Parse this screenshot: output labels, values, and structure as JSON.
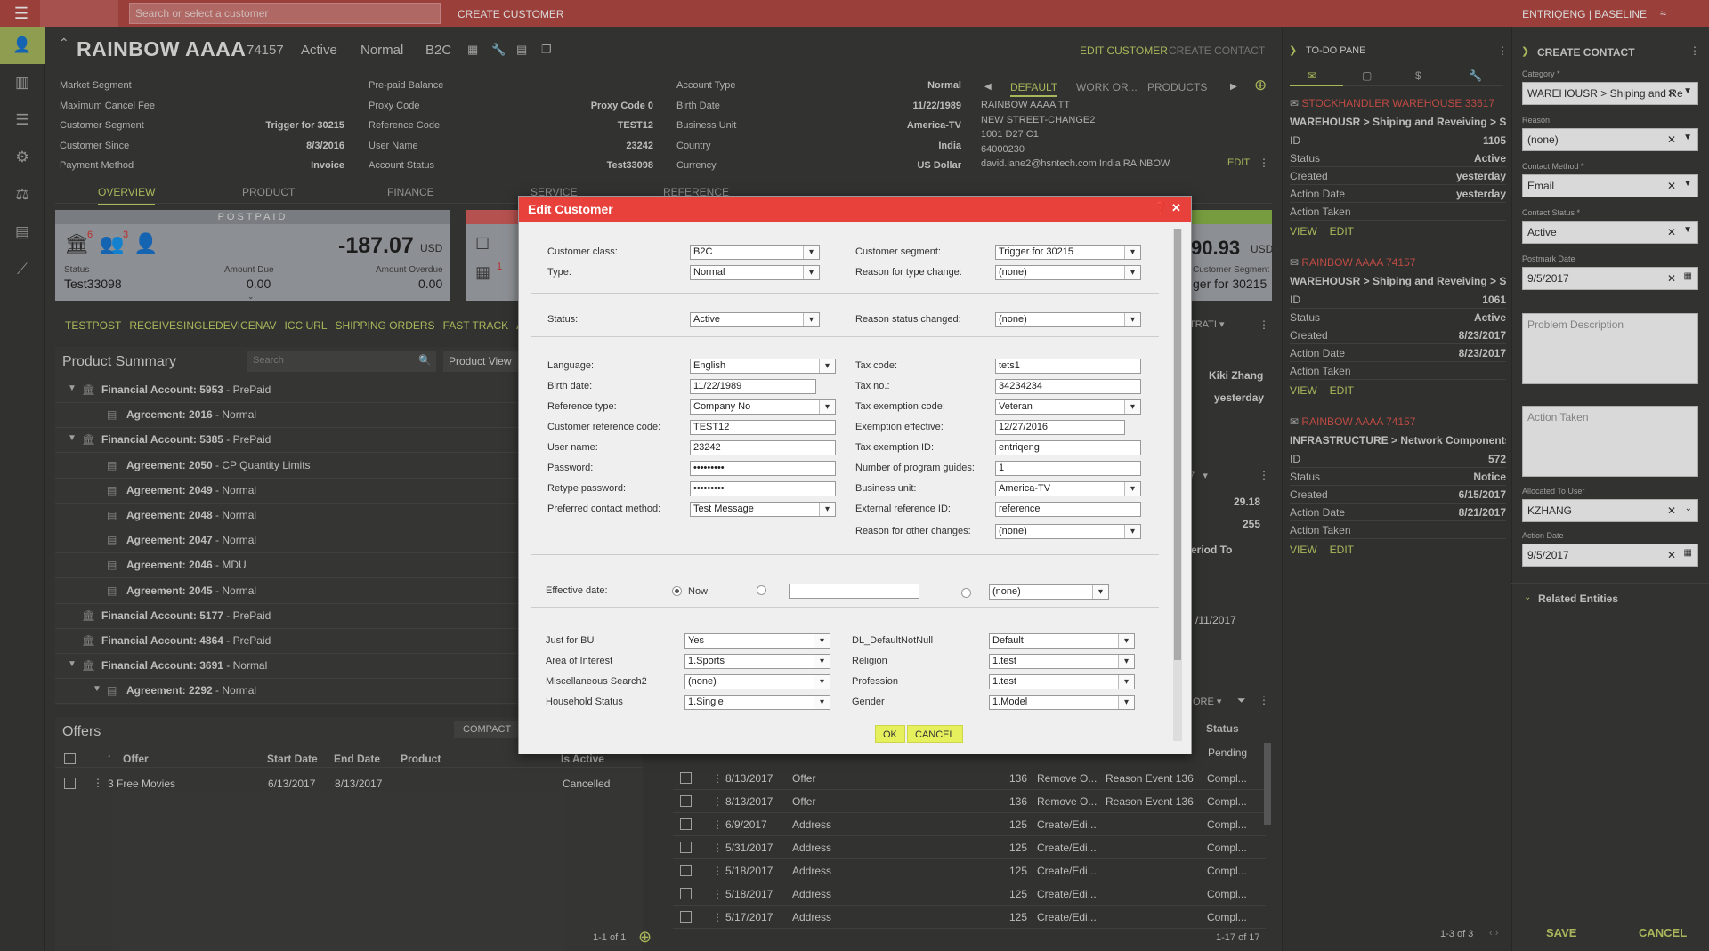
{
  "topbar": {
    "search_placeholder": "Search or select a customer",
    "create_customer": "CREATE CUSTOMER",
    "tenant": "ENTRIQENG | BASELINE"
  },
  "customer": {
    "name": "RAINBOW AAAA",
    "id": "74157",
    "status": "Active",
    "type": "Normal",
    "class": "B2C"
  },
  "actions": {
    "edit_customer": "EDIT CUSTOMER",
    "create_contact": "CREATE CONTACT"
  },
  "info_col1": [
    {
      "label": "Market Segment",
      "value": ""
    },
    {
      "label": "Maximum Cancel Fee",
      "value": ""
    },
    {
      "label": "Customer Segment",
      "value": "Trigger for 30215"
    },
    {
      "label": "Customer Since",
      "value": "8/3/2016"
    },
    {
      "label": "Payment Method",
      "value": "Invoice"
    }
  ],
  "info_col2": [
    {
      "label": "Pre-paid Balance",
      "value": ""
    },
    {
      "label": "Proxy Code",
      "value": "Proxy Code 0"
    },
    {
      "label": "Reference Code",
      "value": "TEST12"
    },
    {
      "label": "User Name",
      "value": "23242"
    },
    {
      "label": "Account Status",
      "value": "Test33098"
    }
  ],
  "info_col3": [
    {
      "label": "Account Type",
      "value": "Normal"
    },
    {
      "label": "Birth Date",
      "value": "11/22/1989"
    },
    {
      "label": "Business Unit",
      "value": "America-TV"
    },
    {
      "label": "Country",
      "value": "India"
    },
    {
      "label": "Currency",
      "value": "US Dollar"
    }
  ],
  "address_tabs": [
    "DEFAULT",
    "WORK OR...",
    "PRODUCTS"
  ],
  "address": {
    "line1": "RAINBOW AAAA TT",
    "line2": "NEW STREET-CHANGE2",
    "line3": "1001 D27 C1",
    "line4": "64000230",
    "line5": "david.lane2@hsntech.com India RAINBOW",
    "edit": "EDIT"
  },
  "main_tabs": [
    "OVERVIEW",
    "PRODUCT",
    "FINANCE",
    "SERVICE",
    "REFERENCE"
  ],
  "postpaid": {
    "title": "POSTPAID",
    "badge1": "6",
    "badge2": "3",
    "balance": "-187.07",
    "currency": "USD",
    "status_label": "Status",
    "status": "Test33098",
    "amount_due_label": "Amount Due",
    "amount_due": "0.00",
    "amount_overdue_label": "Amount Overdue",
    "amount_overdue": "0.00"
  },
  "card3": {
    "balance": "90.93",
    "currency": "USD",
    "seg_label": "Customer Segment",
    "seg": "ger for 30215",
    "badge": "1"
  },
  "links": [
    "TESTPOST",
    "RECEIVESINGLEDEVICENAV",
    "ICC URL",
    "SHIPPING ORDERS",
    "FAST TRACK",
    "AUTO"
  ],
  "product_summary": {
    "title": "Product Summary",
    "search_placeholder": "Search",
    "view_label": "Product View",
    "items": [
      {
        "text": "Financial Account: 5953",
        "suffix": " - PrePaid",
        "level": 0,
        "expand": true
      },
      {
        "text": "Agreement: 2016",
        "suffix": " - Normal",
        "level": 1,
        "expand": false
      },
      {
        "text": "Financial Account: 5385",
        "suffix": " - PrePaid",
        "level": 0,
        "expand": true
      },
      {
        "text": "Agreement: 2050",
        "suffix": " - CP Quantity Limits",
        "level": 1,
        "expand": false
      },
      {
        "text": "Agreement: 2049",
        "suffix": " - Normal",
        "level": 1,
        "expand": false
      },
      {
        "text": "Agreement: 2048",
        "suffix": " - Normal",
        "level": 1,
        "expand": false
      },
      {
        "text": "Agreement: 2047",
        "suffix": " - Normal",
        "level": 1,
        "expand": false
      },
      {
        "text": "Agreement: 2046",
        "suffix": " - MDU",
        "level": 1,
        "expand": false
      },
      {
        "text": "Agreement: 2045",
        "suffix": " - Normal",
        "level": 1,
        "expand": false
      },
      {
        "text": "Financial Account: 5177",
        "suffix": " - PrePaid",
        "level": 0,
        "expand": false
      },
      {
        "text": "Financial Account: 4864",
        "suffix": " - PrePaid",
        "level": 0,
        "expand": false
      },
      {
        "text": "Financial Account: 3691",
        "suffix": " - Normal",
        "level": 0,
        "expand": true
      },
      {
        "text": "Agreement: 2292",
        "suffix": " - Normal",
        "level": 1,
        "expand": true
      }
    ]
  },
  "offers": {
    "title": "Offers",
    "compact": "COMPACT",
    "headers": [
      "Offer",
      "Start Date",
      "End Date",
      "Product",
      "Is Active"
    ],
    "rows": [
      {
        "offer": "3 Free Movies",
        "start": "6/13/2017",
        "end": "8/13/2017",
        "product": "",
        "active": "Cancelled"
      }
    ],
    "pager": "1-1 of 1"
  },
  "right_partial": {
    "name": "Kiki Zhang",
    "when": "yesterday",
    "amt1": "29.18",
    "amt2": "255",
    "period": "eriod To",
    "date": "/11/2017",
    "sel_text": "TRATI",
    "num": "17",
    "more": "ORE"
  },
  "history": {
    "status_header": "Status",
    "pager": "1-17 of 17",
    "rows": [
      {
        "date": "8/13/2017",
        "type": "Offer",
        "num": "136",
        "action": "Remove O...",
        "reason": "Reason Event 136",
        "status": "Compl..."
      },
      {
        "date": "8/13/2017",
        "type": "Offer",
        "num": "136",
        "action": "Remove O...",
        "reason": "Reason Event 136",
        "status": "Compl..."
      },
      {
        "date": "6/9/2017",
        "type": "Address",
        "num": "125",
        "action": "Create/Edi...",
        "reason": "",
        "status": "Compl..."
      },
      {
        "date": "5/31/2017",
        "type": "Address",
        "num": "125",
        "action": "Create/Edi...",
        "reason": "",
        "status": "Compl..."
      },
      {
        "date": "5/18/2017",
        "type": "Address",
        "num": "125",
        "action": "Create/Edi...",
        "reason": "",
        "status": "Compl..."
      },
      {
        "date": "5/18/2017",
        "type": "Address",
        "num": "125",
        "action": "Create/Edi...",
        "reason": "",
        "status": "Compl..."
      },
      {
        "date": "5/17/2017",
        "type": "Address",
        "num": "125",
        "action": "Create/Edi...",
        "reason": "",
        "status": "Compl..."
      }
    ],
    "first_status": "Pending"
  },
  "todo": {
    "title": "TO-DO PANE",
    "pager": "1-3 of 3",
    "items": [
      {
        "head": "STOCKHANDLER WAREHOUSE 33617",
        "sub": "WAREHOUSR > Shiping and Reveiving > Shi...",
        "kv": [
          [
            "ID",
            "1105"
          ],
          [
            "Status",
            "Active"
          ],
          [
            "Created",
            "yesterday"
          ],
          [
            "Action Date",
            "yesterday"
          ],
          [
            "Action Taken",
            ""
          ]
        ]
      },
      {
        "head": "RAINBOW AAAA 74157",
        "sub": "WAREHOUSR > Shiping and Reveiving > Shi...",
        "kv": [
          [
            "ID",
            "1061"
          ],
          [
            "Status",
            "Active"
          ],
          [
            "Created",
            "8/23/2017"
          ],
          [
            "Action Date",
            "8/23/2017"
          ],
          [
            "Action Taken",
            ""
          ]
        ]
      },
      {
        "head": "RAINBOW AAAA 74157",
        "sub": "INFRASTRUCTURE > Network Components ...",
        "kv": [
          [
            "ID",
            "572"
          ],
          [
            "Status",
            "Notice"
          ],
          [
            "Created",
            "6/15/2017"
          ],
          [
            "Action Date",
            "8/21/2017"
          ],
          [
            "Action Taken",
            ""
          ]
        ]
      }
    ],
    "view": "VIEW",
    "edit": "EDIT"
  },
  "create_contact": {
    "title": "CREATE CONTACT",
    "category_label": "Category *",
    "category": "WAREHOUSR > Shiping and Re",
    "reason_label": "Reason",
    "reason": "(none)",
    "method_label": "Contact Method *",
    "method": "Email",
    "status_label": "Contact Status *",
    "status": "Active",
    "postmark_label": "Postmark Date",
    "postmark": "9/5/2017",
    "problem_placeholder": "Problem Description",
    "action_placeholder": "Action Taken",
    "allocated_label": "Allocated To User",
    "allocated": "KZHANG",
    "action_date_label": "Action Date",
    "action_date": "9/5/2017",
    "related": "Related Entities",
    "save": "SAVE",
    "cancel": "CANCEL"
  },
  "modal": {
    "title": "Edit Customer",
    "customer_class_label": "Customer class:",
    "customer_class": "B2C",
    "type_label": "Type:",
    "type": "Normal",
    "customer_segment_label": "Customer segment:",
    "customer_segment": "Trigger for 30215",
    "reason_type_label": "Reason for type change:",
    "reason_type": "(none)",
    "status_label": "Status:",
    "status": "Active",
    "reason_status_label": "Reason status changed:",
    "reason_status": "(none)",
    "language_label": "Language:",
    "language": "English",
    "birth_label": "Birth date:",
    "birth": "11/22/1989",
    "ref_type_label": "Reference type:",
    "ref_type": "Company No",
    "cust_ref_label": "Customer reference code:",
    "cust_ref": "TEST12",
    "user_label": "User name:",
    "user": "23242",
    "pw_label": "Password:",
    "pw": "•••••••••",
    "rpw_label": "Retype password:",
    "rpw": "•••••••••",
    "pref_label": "Preferred contact method:",
    "pref": "Test Message",
    "tax_code_label": "Tax code:",
    "tax_code": "tets1",
    "tax_no_label": "Tax no.:",
    "tax_no": "34234234",
    "tax_ex_label": "Tax exemption code:",
    "tax_ex": "Veteran",
    "ex_eff_label": "Exemption effective:",
    "ex_eff": "12/27/2016",
    "tax_id_label": "Tax exemption ID:",
    "tax_id": "entriqeng",
    "guides_label": "Number of program guides:",
    "guides": "1",
    "bu_label": "Business unit:",
    "bu": "America-TV",
    "ext_label": "External reference ID:",
    "ext": "reference",
    "other_label": "Reason for other changes:",
    "other": "(none)",
    "eff_label": "Effective date:",
    "now": "Now",
    "eff_sel": "(none)",
    "jbu_label": "Just for BU",
    "jbu": "Yes",
    "aoi_label": "Area of Interest",
    "aoi": "1.Sports",
    "misc_label": "Miscellaneous Search2",
    "misc": "(none)",
    "hh_label": "Household Status",
    "hh": "1.Single",
    "dl_label": "DL_DefaultNotNull",
    "dl": "Default",
    "rel_label": "Religion",
    "rel": "1.test",
    "prof_label": "Profession",
    "prof": "1.test",
    "gender_label": "Gender",
    "gender": "1.Model",
    "ok": "OK",
    "cancel": "CANCEL"
  }
}
